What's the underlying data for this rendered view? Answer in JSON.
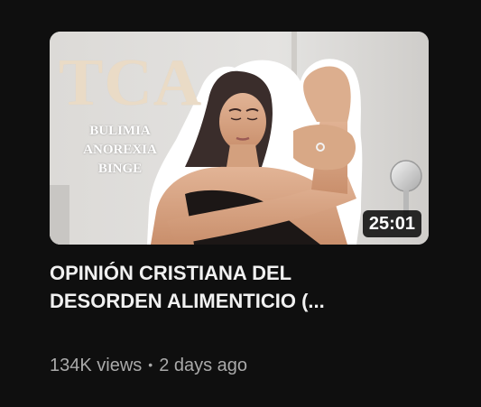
{
  "video": {
    "thumbnail": {
      "headline": "TCA",
      "words": [
        "BULIMIA",
        "ANOREXIA",
        "BINGE"
      ],
      "duration": "25:01"
    },
    "title_lines": [
      "OPINIÓN CRISTIANA DEL",
      "DESORDEN ALIMENTICIO (..."
    ],
    "views": "134K views",
    "separator": "•",
    "age": "2 days ago"
  },
  "colors": {
    "background": "#0f0f0f",
    "title": "#f1f1f1",
    "meta": "#aaaaaa",
    "headline": "#eadbc6"
  }
}
